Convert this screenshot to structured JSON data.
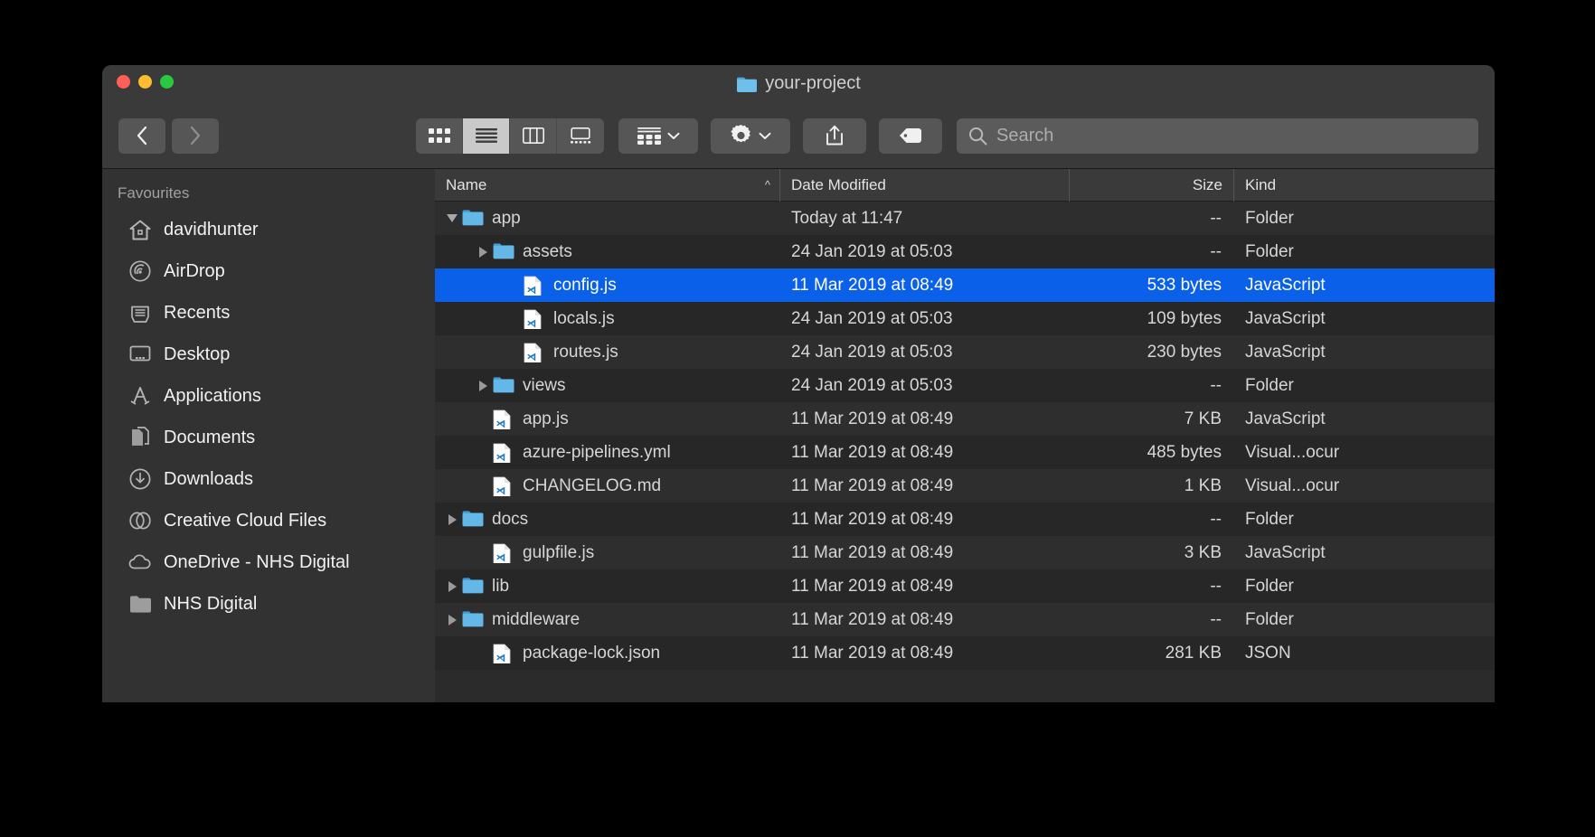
{
  "window": {
    "title": "your-project",
    "traffic_lights": [
      "close",
      "minimize",
      "maximize"
    ],
    "colors": {
      "close": "#ff5f57",
      "minimize": "#febc2e",
      "maximize": "#28c840",
      "selection": "#0a60e8",
      "folder": "#51acdf"
    }
  },
  "toolbar": {
    "back_label": "Back",
    "forward_label": "Forward",
    "view_modes": [
      {
        "name": "icon-view",
        "icon": "grid-icon",
        "active": false
      },
      {
        "name": "list-view",
        "icon": "list-icon",
        "active": true
      },
      {
        "name": "column-view",
        "icon": "columns-icon",
        "active": false
      },
      {
        "name": "gallery-view",
        "icon": "gallery-icon",
        "active": false
      }
    ],
    "arrange_label": "Arrange",
    "action_label": "Action",
    "share_label": "Share",
    "tag_label": "Edit Tags"
  },
  "search": {
    "placeholder": "Search",
    "value": ""
  },
  "sidebar": {
    "heading": "Favourites",
    "items": [
      {
        "label": "davidhunter",
        "icon": "home-icon"
      },
      {
        "label": "AirDrop",
        "icon": "airdrop-icon"
      },
      {
        "label": "Recents",
        "icon": "recents-icon"
      },
      {
        "label": "Desktop",
        "icon": "desktop-icon"
      },
      {
        "label": "Applications",
        "icon": "applications-icon"
      },
      {
        "label": "Documents",
        "icon": "documents-icon"
      },
      {
        "label": "Downloads",
        "icon": "downloads-icon"
      },
      {
        "label": "Creative Cloud Files",
        "icon": "creative-cloud-icon"
      },
      {
        "label": "OneDrive - NHS Digital",
        "icon": "cloud-icon"
      },
      {
        "label": "NHS Digital",
        "icon": "folder-icon"
      }
    ]
  },
  "filelist": {
    "columns": [
      {
        "label": "Name",
        "sorted": "asc"
      },
      {
        "label": "Date Modified",
        "sorted": ""
      },
      {
        "label": "Size",
        "sorted": ""
      },
      {
        "label": "Kind",
        "sorted": ""
      }
    ],
    "rows": [
      {
        "name": "app",
        "date": "Today at 11:47",
        "size": "--",
        "kind": "Folder",
        "type": "folder",
        "indent": 0,
        "twisty": "down",
        "selected": false
      },
      {
        "name": "assets",
        "date": "24 Jan 2019 at 05:03",
        "size": "--",
        "kind": "Folder",
        "type": "folder",
        "indent": 1,
        "twisty": "right",
        "selected": false
      },
      {
        "name": "config.js",
        "date": "11 Mar 2019 at 08:49",
        "size": "533 bytes",
        "kind": "JavaScript",
        "type": "code",
        "indent": 2,
        "twisty": "",
        "selected": true
      },
      {
        "name": "locals.js",
        "date": "24 Jan 2019 at 05:03",
        "size": "109 bytes",
        "kind": "JavaScript",
        "type": "code",
        "indent": 2,
        "twisty": "",
        "selected": false
      },
      {
        "name": "routes.js",
        "date": "24 Jan 2019 at 05:03",
        "size": "230 bytes",
        "kind": "JavaScript",
        "type": "code",
        "indent": 2,
        "twisty": "",
        "selected": false
      },
      {
        "name": "views",
        "date": "24 Jan 2019 at 05:03",
        "size": "--",
        "kind": "Folder",
        "type": "folder",
        "indent": 1,
        "twisty": "right",
        "selected": false
      },
      {
        "name": "app.js",
        "date": "11 Mar 2019 at 08:49",
        "size": "7 KB",
        "kind": "JavaScript",
        "type": "code",
        "indent": 1,
        "twisty": "",
        "selected": false
      },
      {
        "name": "azure-pipelines.yml",
        "date": "11 Mar 2019 at 08:49",
        "size": "485 bytes",
        "kind": "Visual...ocur",
        "type": "code",
        "indent": 1,
        "twisty": "",
        "selected": false
      },
      {
        "name": "CHANGELOG.md",
        "date": "11 Mar 2019 at 08:49",
        "size": "1 KB",
        "kind": "Visual...ocur",
        "type": "code",
        "indent": 1,
        "twisty": "",
        "selected": false
      },
      {
        "name": "docs",
        "date": "11 Mar 2019 at 08:49",
        "size": "--",
        "kind": "Folder",
        "type": "folder",
        "indent": 0,
        "twisty": "right",
        "selected": false
      },
      {
        "name": "gulpfile.js",
        "date": "11 Mar 2019 at 08:49",
        "size": "3 KB",
        "kind": "JavaScript",
        "type": "code",
        "indent": 1,
        "twisty": "",
        "selected": false
      },
      {
        "name": "lib",
        "date": "11 Mar 2019 at 08:49",
        "size": "--",
        "kind": "Folder",
        "type": "folder",
        "indent": 0,
        "twisty": "right",
        "selected": false
      },
      {
        "name": "middleware",
        "date": "11 Mar 2019 at 08:49",
        "size": "--",
        "kind": "Folder",
        "type": "folder",
        "indent": 0,
        "twisty": "right",
        "selected": false
      },
      {
        "name": "package-lock.json",
        "date": "11 Mar 2019 at 08:49",
        "size": "281 KB",
        "kind": "JSON",
        "type": "code",
        "indent": 1,
        "twisty": "",
        "selected": false
      }
    ]
  }
}
